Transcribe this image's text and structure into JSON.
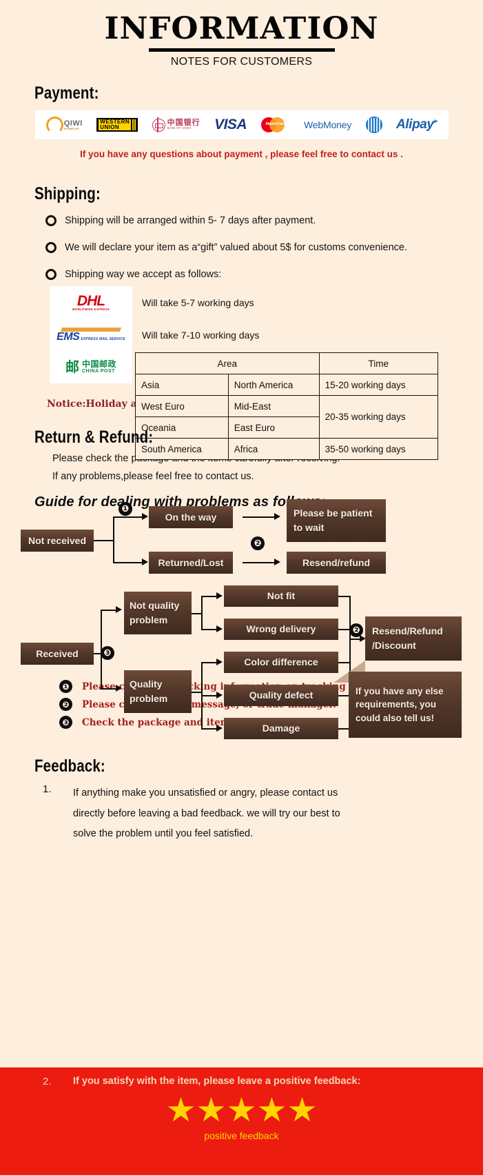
{
  "header": {
    "title": "INFORMATION",
    "subtitle": "NOTES FOR CUSTOMERS"
  },
  "payment": {
    "heading": "Payment:",
    "logos": [
      {
        "name": "qiwi-logo",
        "label": "QIWI",
        "sub": "KOSHELEK"
      },
      {
        "name": "western-union-logo",
        "line1": "WESTERN",
        "line2": "UNION"
      },
      {
        "name": "bank-of-china-logo",
        "label": "中国银行",
        "sub": "BANK OF CHINA"
      },
      {
        "name": "visa-logo",
        "label": "VISA"
      },
      {
        "name": "mastercard-logo",
        "label": "MasterCard"
      },
      {
        "name": "webmoney-logo",
        "label": "WebMoney"
      },
      {
        "name": "globe-logo",
        "label": ""
      },
      {
        "name": "alipay-logo",
        "label": "Alipay"
      }
    ],
    "note": "If you have any questions about payment , please feel free to contact us ."
  },
  "shipping": {
    "heading": "Shipping:",
    "bullets": [
      "Shipping will be arranged within  5- 7  days after payment.",
      "We will declare your item as a“gift” valued about 5$ for customs convenience.",
      "Shipping way we accept as follows:"
    ],
    "carriers": [
      {
        "logo": "dhl-logo",
        "name": "DHL",
        "tagline": "WORLDWIDE EXPRESS",
        "text": "Will take 5-7 working days"
      },
      {
        "logo": "ems-logo",
        "name": "EMS",
        "tagline": "EXPRESS MAIL SERVICE",
        "text": "Will take 7-10 working days"
      },
      {
        "logo": "china-post-logo",
        "name": "中国邮政",
        "tagline": "CHINA  POST",
        "text": ""
      }
    ],
    "table": {
      "headers": [
        "Area",
        "Time"
      ],
      "rows": [
        {
          "a": "Asia",
          "b": "North America",
          "time": "15-20 working days"
        },
        {
          "a": "West Euro",
          "b": "Mid-East",
          "time": "20-35 working days"
        },
        {
          "a": "Oceania",
          "b": "East Euro",
          "time": ""
        },
        {
          "a": "South America",
          "b": "Africa",
          "time": "35-50 working days"
        }
      ]
    },
    "notice": "Notice:Holiday and Weekend are not included in working days."
  },
  "return_refund": {
    "heading": "Return & Refund:",
    "lines": [
      "Please check the package and the items carefully after receiving.",
      "If any problems,please feel free to contact us."
    ],
    "guide_heading": "Guide for dealing with problems as follows:"
  },
  "flowchart_not_received": {
    "source": "Not received",
    "marker1": "❶",
    "marker2": "❷",
    "branches": [
      "On the way",
      "Returned/Lost"
    ],
    "outcomes": [
      "Please be patient to wait",
      "Resend/refund"
    ],
    "outcome1_line1": "Please be patient",
    "outcome1_line2": "to wait"
  },
  "flowchart_received": {
    "source": "Received",
    "marker3": "❸",
    "marker2": "❷",
    "category1_line1": "Not quality",
    "category1_line2": "problem",
    "category2_line1": "Quality",
    "category2_line2": "problem",
    "issues_not_quality": [
      "Not fit",
      "Wrong delivery"
    ],
    "issues_quality": [
      "Color difference",
      "Quality defect",
      "Damage"
    ],
    "result_line1": "Resend/Refund",
    "result_line2": "/Discount",
    "callout_line1": "If you have any else",
    "callout_line2": "requirements, you",
    "callout_line3": "could also tell us!"
  },
  "legend": [
    {
      "num": "❶",
      "text": "Please check the tracking information on tracking website."
    },
    {
      "num": "❷",
      "text": "Please contact us by message, or trade manager."
    },
    {
      "num": "❸",
      "text": "Check the package and item carefully."
    }
  ],
  "feedback": {
    "heading": "Feedback:",
    "item1_num": "1.",
    "item1_line1": "If anything make you unsatisfied or angry, please contact us",
    "item1_line2": "directly before leaving a bad feedback. we will try our best to",
    "item1_line3": "solve the problem until  you feel satisfied.",
    "item2_num": "2.",
    "item2_text": "If you satisfy with the item, please leave a positive feedback:",
    "stars": 5,
    "caption": "positive feedback"
  },
  "colors": {
    "background": "#fdeedd",
    "red_band": "#ec1c10",
    "star": "#ffd400",
    "note_red": "#c21f1f",
    "notice_dark_red": "#8e1f25",
    "flow_box": "#53382a"
  }
}
